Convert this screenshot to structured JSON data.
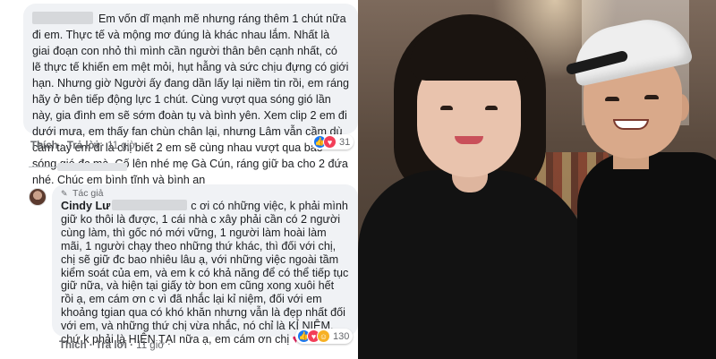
{
  "comment1": {
    "text": "Em vốn dĩ mạnh mẽ nhưng ráng thêm 1 chút nữa đi em. Thực tế và mộng mơ đúng là khác nhau lắm. Nhất là giai đoạn con nhỏ thì mình cần người thân bên cạnh nhất, có lẽ thực tế khiến em mệt mỏi, hụt hẫng và sức chịu đựng có giới hạn. Nhưng giờ Người ấy đang dần lấy lại niềm tin rồi, em ráng hãy ở bên tiếp động lực 1 chút. Cùng vượt qua sóng gió lần này, gia đình em sẽ sớm đoàn tụ và bình yên. Xem clip 2 em đi dưới mưa, em thấy fan chùn chân lại, nhưng Lâm vẫn cầm dù cầm tay em đi là chị biết 2 em sẽ cùng nhau vượt qua bao sóng gió đc mà. Cố lên nhé mẹ Gà Cún, ráng giữ ba cho 2 đứa nhé. Chúc em bình tĩnh và bình an",
    "like_label": "Thích",
    "reply_label": "Trả lời",
    "time": "11 giờ",
    "reaction_count": "31"
  },
  "reply": {
    "badge": "Tác giả",
    "author": "Cindy Lư",
    "text": "c ơi có những việc, k phải mình giữ ko thôi là được, 1 cái nhà c xây phải cần có 2 người cùng làm, thì gốc nó mới vững, 1 người làm hoài làm mãi, 1 người chạy theo những thứ khác, thì đối với chị, chị sẽ giữ đc bao nhiêu lâu ạ, với những việc ngoài tầm kiểm soát của em, và em k có khả năng để có thể tiếp tục giữ nữa, và hiện tại giấy tờ bon em cũng xong xuôi hết rồi ạ, em cám ơn c vì đã nhắc lại kỉ niệm, đối với em khoảng tgian qua có khó khăn nhưng vẫn là đẹp nhất đối với em, và những thứ chị vừa nhắc, nó chỉ là KỈ NIỆM, chứ k phải là HIỆN TẠI nữa ạ, em cám ơn chị",
    "heart": "♥",
    "like_label": "Thích",
    "reply_label": "Trả lời",
    "time": "11 giờ",
    "reaction_count": "130"
  },
  "icons": {
    "like": "like-icon",
    "love": "love-icon",
    "care": "care-icon",
    "author_badge": "author-badge-icon"
  },
  "colors": {
    "bubble": "#f0f2f5",
    "like": "#1877f2",
    "love": "#f33e58",
    "meta_text": "#65676b"
  }
}
